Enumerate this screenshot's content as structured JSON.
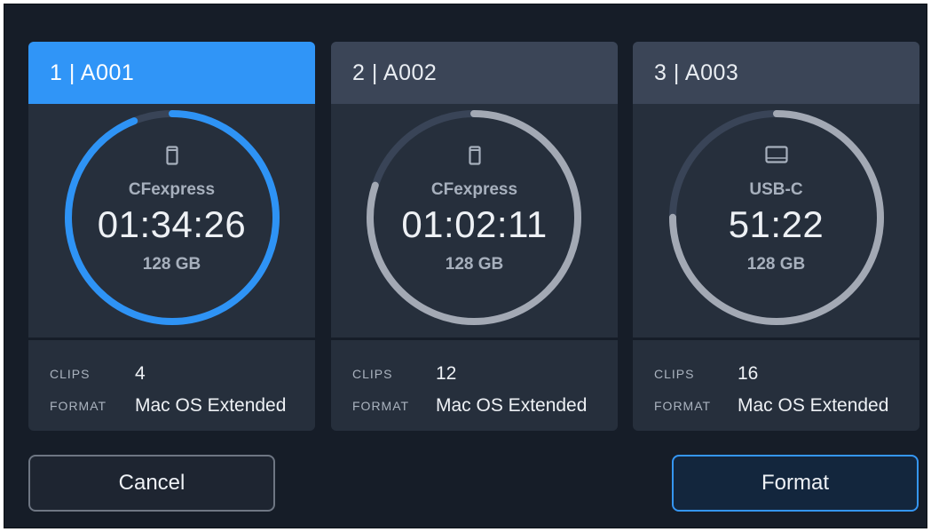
{
  "cards": [
    {
      "header": "1 | A001",
      "selected": true,
      "media_type": "CFexpress",
      "media_icon": "cfexpress-card-icon",
      "time_remaining": "01:34:26",
      "capacity": "128 GB",
      "usage_fraction": 0.94,
      "ring_color": "#2e93f5",
      "clips_label": "CLIPS",
      "clips_value": "4",
      "format_label": "FORMAT",
      "format_value": "Mac OS Extended"
    },
    {
      "header": "2 | A002",
      "selected": false,
      "media_type": "CFexpress",
      "media_icon": "cfexpress-card-icon",
      "time_remaining": "01:02:11",
      "capacity": "128 GB",
      "usage_fraction": 0.8,
      "ring_color": "#a3a9b4",
      "clips_label": "CLIPS",
      "clips_value": "12",
      "format_label": "FORMAT",
      "format_value": "Mac OS Extended"
    },
    {
      "header": "3 | A003",
      "selected": false,
      "media_type": "USB-C",
      "media_icon": "usb-drive-icon",
      "time_remaining": "51:22",
      "capacity": "128 GB",
      "usage_fraction": 0.75,
      "ring_color": "#a3a9b4",
      "clips_label": "CLIPS",
      "clips_value": "16",
      "format_label": "FORMAT",
      "format_value": "Mac OS Extended"
    }
  ],
  "buttons": {
    "cancel_label": "Cancel",
    "format_label": "Format"
  },
  "colors": {
    "accent": "#3095f7",
    "ring_track": "#394457",
    "background": "#161d28"
  }
}
